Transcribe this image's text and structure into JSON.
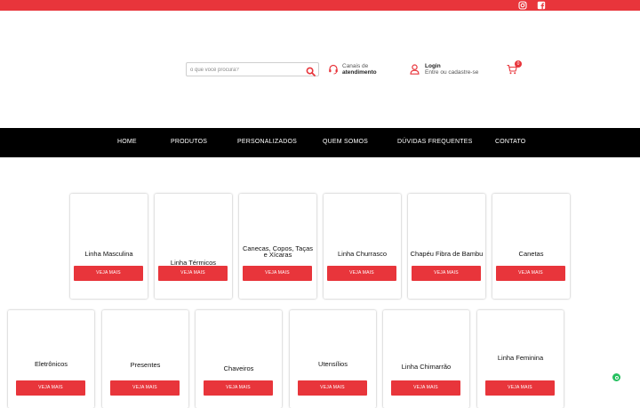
{
  "search": {
    "placeholder": "o que você procura?"
  },
  "contact": {
    "line1": "Canais de",
    "line2": "atendimento"
  },
  "account": {
    "title": "Login",
    "subtitle": "Entre ou cadastre-se"
  },
  "cart": {
    "count": "0"
  },
  "nav": {
    "home": "HOME",
    "produtos": "PRODUTOS",
    "personalizados": "PERSONALIZADOS",
    "quem_somos": "QUEM SOMOS",
    "duvidas": "DÚVIDAS FREQUENTES",
    "contato": "CONTATO"
  },
  "categories_row1": [
    {
      "title": "Linha Masculina",
      "button": "VEJA MAIS"
    },
    {
      "title": "Linha Térmicos",
      "button": "VEJA MAIS"
    },
    {
      "title_line1": "Canecas, Copos, Taças",
      "title_line2": "e Xícaras",
      "button": "VEJA MAIS"
    },
    {
      "title": "Linha Churrasco",
      "button": "VEJA MAIS"
    },
    {
      "title": "Chapéu Fibra de Bambu",
      "button": "VEJA MAIS"
    },
    {
      "title": "Canetas",
      "button": "VEJA MAIS"
    }
  ],
  "categories_row2": [
    {
      "title": "Eletrônicos",
      "button": "VEJA MAIS"
    },
    {
      "title": "Presentes",
      "button": "VEJA MAIS"
    },
    {
      "title": "Chaveiros",
      "button": "VEJA MAIS"
    },
    {
      "title": "Utensílios",
      "button": "VEJA MAIS"
    },
    {
      "title": "Linha Chimarrão",
      "button": "VEJA MAIS"
    },
    {
      "title": "Linha Feminina",
      "button": "VEJA MAIS"
    }
  ],
  "colors": {
    "accent": "#e8353b",
    "nav_bg": "#000000",
    "whatsapp": "#25c05f"
  }
}
